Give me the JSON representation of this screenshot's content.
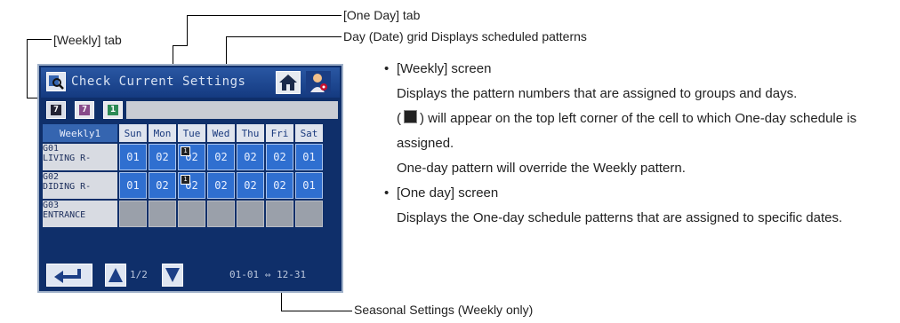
{
  "callouts": {
    "weekly_tab": "[Weekly] tab",
    "one_day_tab": "[One Day] tab",
    "day_grid": "Day (Date) grid Displays scheduled patterns",
    "seasonal": "Seasonal Settings (Weekly only)"
  },
  "screen": {
    "title": "Check Current Settings",
    "tabs": [
      "7",
      "7",
      "1"
    ],
    "grid": {
      "corner": "Weekly1",
      "days": [
        "Sun",
        "Mon",
        "Tue",
        "Wed",
        "Thu",
        "Fri",
        "Sat"
      ],
      "rows": [
        {
          "group": "G01",
          "name": "LIVING R-",
          "cells": [
            "01",
            "02",
            "02",
            "02",
            "02",
            "02",
            "01"
          ],
          "one_day": [
            false,
            false,
            true,
            false,
            false,
            false,
            false
          ]
        },
        {
          "group": "G02",
          "name": "DIDING R-",
          "cells": [
            "01",
            "02",
            "02",
            "02",
            "02",
            "02",
            "01"
          ],
          "one_day": [
            false,
            false,
            true,
            false,
            false,
            false,
            false
          ]
        },
        {
          "group": "G03",
          "name": "ENTRANCE",
          "cells": [
            "",
            "",
            "",
            "",
            "",
            "",
            ""
          ],
          "one_day": [
            false,
            false,
            false,
            false,
            false,
            false,
            false
          ]
        }
      ]
    },
    "page_indicator": "1/2",
    "season_range": "01-01 ⇔ 12-31",
    "colors": {
      "screen_bg": "#0f2f6a",
      "cell": "#2f6fd0",
      "empty_cell": "#9aa0aa"
    }
  },
  "description": {
    "weekly_heading": "[Weekly] screen",
    "weekly_line1": "Displays the pattern numbers that are assigned to groups and days.",
    "weekly_line2_pre": "(",
    "weekly_line2_post": ") will appear on the top left corner of the cell to which One-day schedule is assigned.",
    "weekly_line3": "One-day pattern will override the Weekly pattern.",
    "oneday_heading": "[One day] screen",
    "oneday_line1": "Displays the One-day schedule patterns that are assigned to specific dates."
  }
}
